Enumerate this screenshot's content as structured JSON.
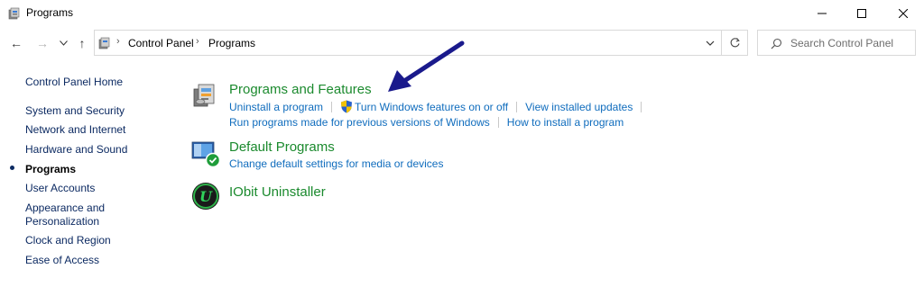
{
  "window": {
    "title": "Programs",
    "icon": "control-panel-icon",
    "controls": {
      "minimize": "minimize-icon",
      "maximize": "maximize-icon",
      "close": "close-icon"
    }
  },
  "nav": {
    "back": "←",
    "forward": "→",
    "recent": "⌄",
    "up": "↑"
  },
  "address": {
    "breadcrumbs": [
      "Control Panel",
      "Programs"
    ],
    "separator": "›"
  },
  "search": {
    "placeholder": "Search Control Panel"
  },
  "sidebar": {
    "items": [
      {
        "label": "Control Panel Home",
        "current": false
      },
      {
        "label": "System and Security",
        "current": false
      },
      {
        "label": "Network and Internet",
        "current": false
      },
      {
        "label": "Hardware and Sound",
        "current": false
      },
      {
        "label": "Programs",
        "current": true
      },
      {
        "label": "User Accounts",
        "current": false
      },
      {
        "label": "Appearance and",
        "current": false
      },
      {
        "label": "Personalization",
        "current": false
      },
      {
        "label": "Clock and Region",
        "current": false
      },
      {
        "label": "Ease of Access",
        "current": false
      }
    ]
  },
  "categories": [
    {
      "title": "Programs and Features",
      "icon": "programs-features-icon",
      "links": [
        [
          "Uninstall a program",
          "Turn Windows features on or off",
          "View installed updates"
        ],
        [
          "Run programs made for previous versions of Windows",
          "How to install a program"
        ]
      ]
    },
    {
      "title": "Default Programs",
      "icon": "default-programs-icon",
      "links": [
        [
          "Change default settings for media or devices"
        ]
      ]
    },
    {
      "title": "IObit Uninstaller",
      "icon": "iobit-uninstaller-icon",
      "links": []
    }
  ],
  "iobit_letter": "U",
  "colors": {
    "category_title": "#1b8a2e",
    "link": "#0f6cbd",
    "sidebar_link": "#0c2a62",
    "annotation_arrow": "#1a1a8c"
  }
}
